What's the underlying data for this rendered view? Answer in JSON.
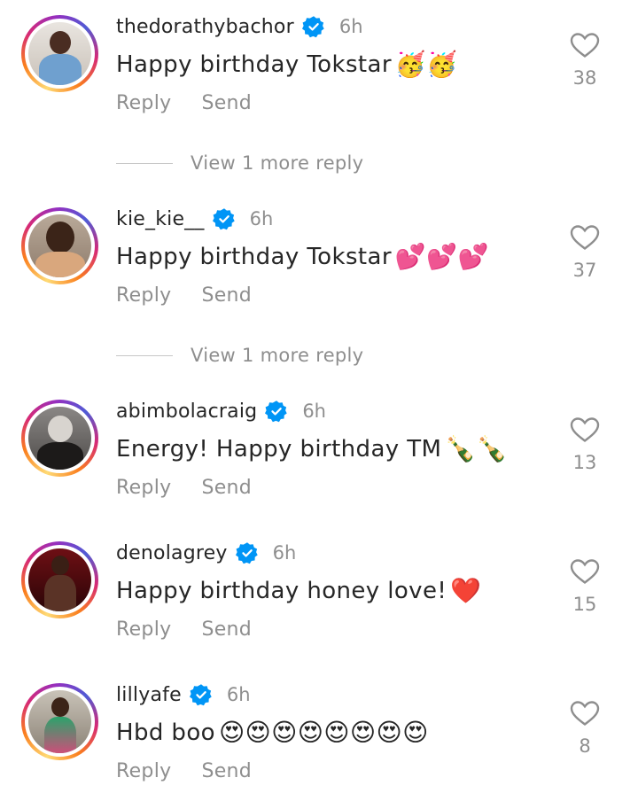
{
  "comments": [
    {
      "username": "thedorathybachor",
      "time": "6h",
      "text": "Happy birthday Tokstar",
      "emoji": "🥳🥳",
      "reply": "Reply",
      "send": "Send",
      "likes": "38",
      "view_more": "View 1 more reply"
    },
    {
      "username": "kie_kie__",
      "time": "6h",
      "text": "Happy birthday Tokstar",
      "emoji": "💕💕💕",
      "reply": "Reply",
      "send": "Send",
      "likes": "37",
      "view_more": "View 1 more reply"
    },
    {
      "username": "abimbolacraig",
      "time": "6h",
      "text": "Energy! Happy birthday TM",
      "emoji": "🍾🍾",
      "reply": "Reply",
      "send": "Send",
      "likes": "13"
    },
    {
      "username": "denolagrey",
      "time": "6h",
      "text": "Happy birthday honey love!",
      "emoji": "❤️",
      "reply": "Reply",
      "send": "Send",
      "likes": "15"
    },
    {
      "username": "lillyafe",
      "time": "6h",
      "text": "Hbd boo",
      "emoji": "😍😍😍😍😍😍😍😍",
      "reply": "Reply",
      "send": "Send",
      "likes": "8"
    }
  ],
  "icons": {
    "verified": "verified-badge-icon",
    "like": "heart-outline-icon"
  },
  "colors": {
    "verified_blue": "#0095f6",
    "muted_text": "#8e8e8e",
    "primary_text": "#262626"
  }
}
